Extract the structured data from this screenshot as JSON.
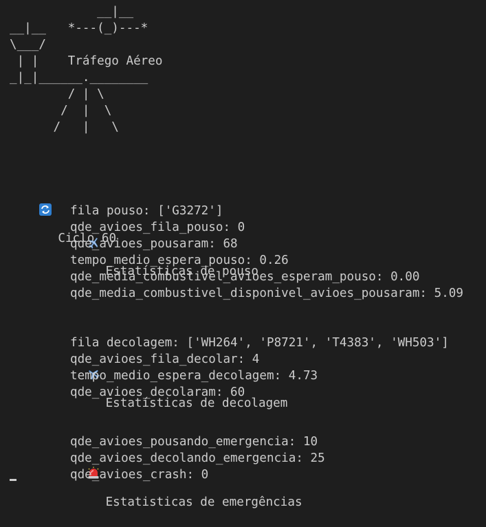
{
  "ascii_art": "            __|__\n__|__   *---(_)---*\n\\___/\n | |    Tráfego Aéreo\n_|_|______.________\n        / | \\\n       /  |  \\\n      /   |   \\",
  "cycle": {
    "icon": "repeat-arrows-icon",
    "label": "Ciclo 60"
  },
  "landing": {
    "icon": "airplane-landing-icon",
    "title": "Estatísticas de pouso",
    "lines": [
      "fila pouso: ['G3272']",
      "qde_avioes_fila_pouso: 0",
      "qde_avioes_pousaram: 68",
      "tempo_medio_espera_pouso: 0.26",
      "qde_media_combustivel_avioes_esperam_pouso: 0.00",
      "qde_media_combustivel_disponivel_avioes_pousaram: 5.09"
    ]
  },
  "takeoff": {
    "icon": "airplane-departure-icon",
    "title": "Estatísticas de decolagem",
    "lines": [
      "fila decolagem: ['WH264', 'P8721', 'T4383', 'WH503']",
      "qde_avioes_fila_decolar: 4",
      "tempo_medio_espera_decolagem: 4.73",
      "qde_avioes_decolaram: 60"
    ]
  },
  "emergency": {
    "icon": "siren-light-icon",
    "title": "Estatisticas de emergências",
    "lines": [
      "qde_avioes_pousando_emergencia: 10",
      "qde_avioes_decolando_emergencia: 25",
      "qde_avioes_crash: 0"
    ]
  },
  "colors": {
    "background": "#1e1e1e",
    "foreground": "#cccccc",
    "cycle_icon_bg": "#2f7fd1",
    "siren_red": "#e03131"
  }
}
